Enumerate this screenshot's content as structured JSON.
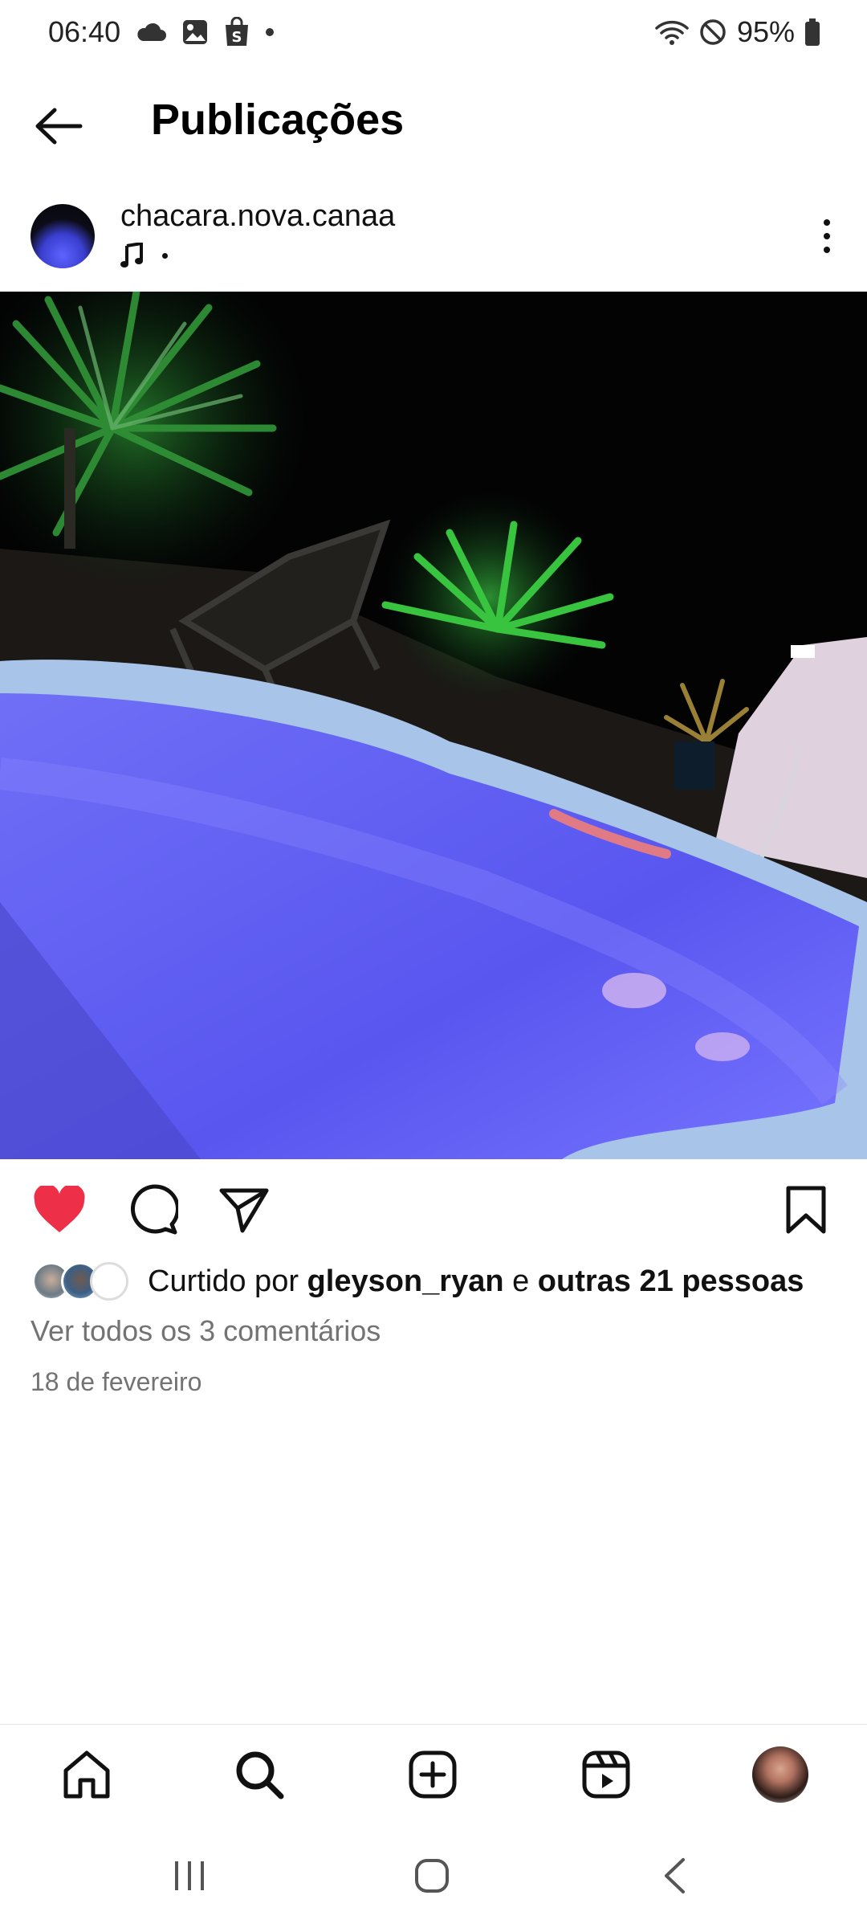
{
  "status_bar": {
    "time": "06:40",
    "battery": "95%",
    "icons": [
      "cloud-icon",
      "gallery-icon",
      "shop-bag-icon",
      "dot-icon",
      "wifi-icon",
      "no-disturb-icon",
      "battery-icon"
    ]
  },
  "header": {
    "title": "Publicações",
    "back_icon": "arrow-left-icon"
  },
  "post": {
    "username": "chacara.nova.canaa",
    "audio_icon": "music-note-icon",
    "image_description_icon": "pool-night-photo",
    "liked": true,
    "likes": {
      "prefix": "Curtido por ",
      "user": "gleyson_ryan",
      "middle": " e ",
      "others": "outras 21 pessoas"
    },
    "comments_link": "Ver todos os 3 comentários",
    "date": "18 de fevereiro"
  },
  "actions": [
    "heart-icon",
    "comment-icon",
    "share-icon",
    "bookmark-icon"
  ],
  "bottom_nav": [
    "home-icon",
    "search-icon",
    "create-icon",
    "reels-icon",
    "profile-avatar"
  ],
  "system_nav": [
    "recents-icon",
    "home-circle-icon",
    "back-chevron-icon"
  ],
  "colors": {
    "like_red": "#ed2f48",
    "secondary_text": "#737373",
    "pool_blue": "#5a5cf2"
  }
}
